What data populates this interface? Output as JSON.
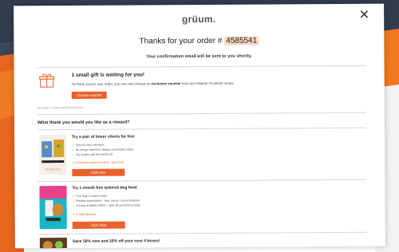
{
  "brand": {
    "logo": "grüum.",
    "accent": "#e9622b",
    "highlight": "#f9d8c2"
  },
  "header": {
    "title_prefix": "Thanks for your order #",
    "order_number": "4585541",
    "subtitle": "Your confirmation email will be sent to you shortly.",
    "close_icon": "close-icon",
    "close_glyph": "✕"
  },
  "gift": {
    "icon": "gift-icon",
    "title": "1 small gift is waiting for you!",
    "text_before": "To thank you for your order, you can now choose an ",
    "text_bold": "exclusive voucher",
    "text_after": " from our network of partner shops.",
    "button": "Choose voucher",
    "fine_print": "Information on data protection by Sovendus"
  },
  "question": "What thank you would you like as a reward?",
  "offers": [
    {
      "title": "Try a pair of boxer shorts for free",
      "bullets": [
        "Only for new members",
        "No strings attached, always cancelable online",
        "Top quality with the perfect fit"
      ],
      "urgency": "Extremely popular product - get it fast!",
      "button": "Click here",
      "image_caption": "The pair for free"
    },
    {
      "title": "Try 1 month free tailored dog food",
      "bullets": [
        "Your dog's unique recipe",
        "Flexible subscription - skip, pause, cancel anytime",
        "1st bag of kibble FREE + 30% off wet food & treats"
      ],
      "urgency": "In high demand!",
      "button": "Click here"
    },
    {
      "title": "Save 50% now and 25% off your next 4 boxes!"
    }
  ]
}
